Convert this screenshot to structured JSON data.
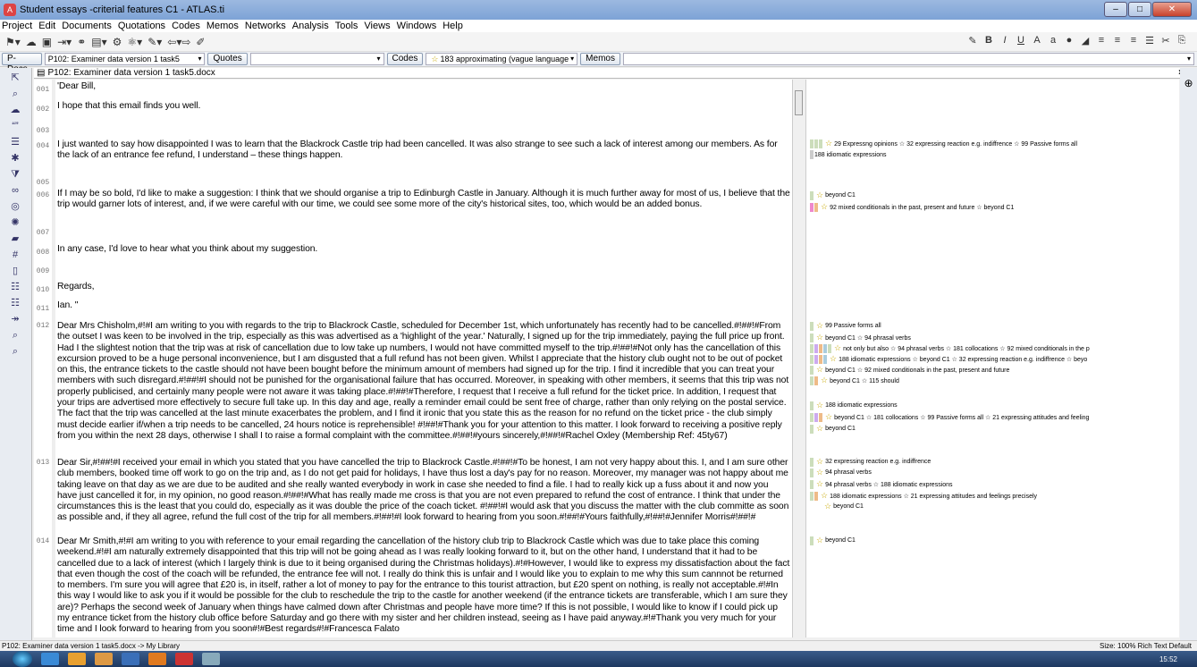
{
  "window": {
    "title": "Student essays -criterial features C1 - ATLAS.ti"
  },
  "menu": [
    "Project",
    "Edit",
    "Documents",
    "Quotations",
    "Codes",
    "Memos",
    "Networks",
    "Analysis",
    "Tools",
    "Views",
    "Windows",
    "Help"
  ],
  "selectors": {
    "pdocs_btn": "P-Docs",
    "pdoc_value": "P102: Examiner data version 1 task5",
    "quotes_btn": "Quotes",
    "codes_btn": "Codes",
    "code_value": "183 approximating (vague language",
    "memos_btn": "Memos"
  },
  "doc_tab": {
    "title": "P102: Examiner data version 1 task5.docx"
  },
  "paragraphs": [
    {
      "n": "001",
      "text": "'Dear Bill,"
    },
    {
      "n": "002",
      "text": "I hope that this email finds you well."
    },
    {
      "n": "003",
      "text": ""
    },
    {
      "n": "004",
      "text": "I just wanted to say how disappointed I was to learn that the Blackrock Castle trip had been cancelled. It was also strange to see such a lack of interest among our members. As for the lack of an entrance fee refund, I understand – these things happen."
    },
    {
      "n": "005",
      "text": ""
    },
    {
      "n": "006",
      "text": "If I may be so bold, I'd like to make a suggestion: I think that we should organise a trip to Edinburgh Castle in January. Although it is much further away for most of us, I believe that the trip would garner lots of interest, and, if we were careful with our time, we could see some more of the city's historical sites, too, which would be an added bonus."
    },
    {
      "n": "007",
      "text": ""
    },
    {
      "n": "008",
      "text": "In any case, I'd love to hear what you think about my suggestion."
    },
    {
      "n": "009",
      "text": ""
    },
    {
      "n": "010",
      "text": "Regards,"
    },
    {
      "n": "011",
      "text": "Ian. \""
    },
    {
      "n": "012",
      "text": "Dear Mrs Chisholm,#!#I am writing to you with regards to the trip to Blackrock Castle, scheduled for December 1st, which unfortunately has recently had to be cancelled.#!##!#From the outset I was keen to be involved in the trip, especially as this was advertised as a 'highlight of the year.'  Naturally, I signed up for the trip immediately, paying the full price up front. Had I the slightest notion that the trip was at risk of cancellation due to low take up numbers, I would not have committed myself to the trip.#!##!#Not only has the cancellation of this excursion proved to be a huge personal inconvenience, but I am disgusted that a full refund has not been given.  Whilst I appreciate that the history club ought not to be out of pocket on this, the entrance tickets to the castle should not have been bought before the minimum amount of members had signed up for the trip.  I find it incredible that you can treat your members with such disregard.#!##!#I should not be punished for the organisational failure that has occurred.  Moreover, in speaking with other members, it seems that this trip was not properly publicised, and certainly many people were not aware it was taking place.#!##!#Therefore, I request that I receive a full refund for the ticket price.  In addition, I request that your trips are advertised more effectively to secure full take up.  In this day and age, really a reminder email could be sent free of charge, rather than only relying on the postal service.  The fact that the trip was cancelled at the last minute exacerbates the problem, and I find it ironic that you state this as the reason for no refund on the ticket price - the club simply must decide earlier if/when a trip needs to be cancelled, 24 hours notice is reprehensible! #!##!#Thank you for your attention to this matter.  I look forward to receiving a positive reply from you within the next 28 days, otherwise I shall I to raise a formal complaint with the committee.#!##!#yours sincerely,#!##!#Rachel Oxley (Membership Ref: 45ty67)"
    },
    {
      "n": "013",
      "text": "Dear Sir,#!##!#I received your email in which you stated that you have cancelled the trip to Blackrock Castle.#!##!#To be honest, I am not very happy about this.  I, and I am sure other club members, booked time off work to go on the trip and, as I do not get paid for holidays, I have thus lost a day's pay for no reason.  Moreover, my manager was not happy about me taking leave on that day as we are due to be audited and she really wanted everybody in work in case she needed to find a file.  I had to really kick up a fuss about it and now you have just cancelled it for, in my opinion, no good reason.#!##!#What has really made me cross is that you are not even prepared to refund the cost of entrance.  I think that under the circumstances this is the least that you could do, especially as it was double the price of the coach ticket.  #!##!#I would ask that you discuss the matter with the club committe as soon as possible and, if they all agree, refund the full cost of the trip for all members.#!##!#I look forward to hearing from you soon.#!##!#Yours faithfully,#!##!#Jennifer Morris#!##!#"
    },
    {
      "n": "014",
      "text": "Dear Mr Smith,#!#I am writing to you with reference to your email regarding the cancellation of the history club trip to Blackrock Castle which was due to take place this coming weekend.#!#I am naturally extremely disappointed that this trip will not be going ahead as I was really looking forward to it, but on the other hand, I understand that it had to be cancelled due to a lack of interest (which I largely think is due to it being organised during the Christmas holidays).#!#However, I would like to express my dissatisfaction about the fact that even though the cost of the coach will be refunded, the entrance fee will not. I really do think this is unfair and I would like you to explain to me why this sum cannnot be returned to members. I'm sure you will agree that £20 is, in itself, rather a lot of money to pay for the entrance to this tourist attraction, but £20 spent on nothing, is really not acceptable.#!#In this way I would like to ask you if it would be possible for the club to reschedule the trip to the castle for another weekend (if the entrance tickets are transferable, which I am sure they are)? Perhaps the second week of January when things have calmed down after Christmas and people have more time? If this is not possible, I would like to know if I could pick up my entrance ticket from the history club office before Saturday and go there with my sister and her children instead, seeing as I have paid anyway.#!#Thank you very much for your time and I look forward to hearing from you soon#!#Best regards#!#Francesca Falato"
    }
  ],
  "codes": [
    "29 Expressng opinions ☆ 32 expressing reaction e.g. indiffrence ☆ 99 Passive forms all",
    "188 idiomatic expressions",
    "beyond C1",
    "92 mixed conditionals in the past, present and future ☆ beyond C1",
    "99 Passive forms all",
    "beyond C1 ☆ 94 phrasal verbs",
    "not only but also ☆ 94 phrasal verbs ☆ 181 collocations ☆ 92 mixed conditionals in the p",
    "188 idiomatic expressions ☆ beyond C1 ☆ 32 expressing reaction e.g. indiffrence ☆ beyo",
    "beyond C1 ☆ 92 mixed conditionals in the past, present and future",
    "beyond C1 ☆ 115 should",
    "188 idiomatic expressions",
    "beyond C1 ☆ 181 collocations ☆ 99 Passive forms all ☆ 21 expressing attitudes and feeling",
    "beyond C1",
    "32 expressing reaction e.g. indiffrence",
    "94 phrasal verbs",
    "94 phrasal verbs ☆ 188 idiomatic expressions",
    "188 idiomatic expressions ☆ 21 expressing attitudes and feelings precisely",
    "beyond C1",
    "beyond C1"
  ],
  "status": {
    "left": "P102: Examiner data version 1 task5.docx -> My Library",
    "right": "Size: 100%    Rich Text  Default"
  },
  "clock": "15:52"
}
